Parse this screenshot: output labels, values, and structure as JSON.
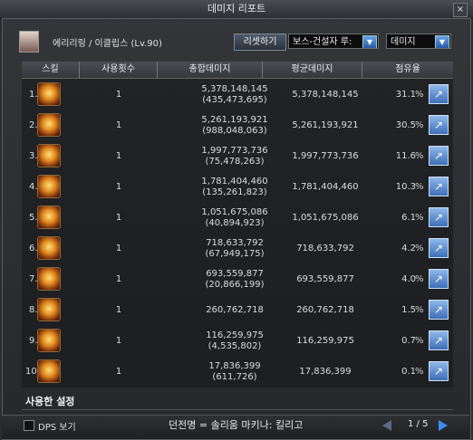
{
  "window": {
    "title": "데미지 리포트",
    "close": "×"
  },
  "header": {
    "character": "에리리링 / 이클립스 (Lv.90)",
    "reset_label": "리셋하기",
    "dungeon_select": "보스-건설자 루:",
    "mode_select": "데미지",
    "dropdown_arrow": "▼"
  },
  "table": {
    "headers": [
      "스킬",
      "사용횟수",
      "총합데미지",
      "평균데미지",
      "점유율"
    ],
    "rows": [
      {
        "rank": "1.",
        "uses": "1",
        "total": "5,378,148,145",
        "sub": "(435,473,695)",
        "avg": "5,378,148,145",
        "share": "31.1",
        "pct": "%"
      },
      {
        "rank": "2.",
        "uses": "1",
        "total": "5,261,193,921",
        "sub": "(988,048,063)",
        "avg": "5,261,193,921",
        "share": "30.5",
        "pct": "%"
      },
      {
        "rank": "3.",
        "uses": "1",
        "total": "1,997,773,736",
        "sub": "(75,478,263)",
        "avg": "1,997,773,736",
        "share": "11.6",
        "pct": "%"
      },
      {
        "rank": "4.",
        "uses": "1",
        "total": "1,781,404,460",
        "sub": "(135,261,823)",
        "avg": "1,781,404,460",
        "share": "10.3",
        "pct": "%"
      },
      {
        "rank": "5.",
        "uses": "1",
        "total": "1,051,675,086",
        "sub": "(40,894,923)",
        "avg": "1,051,675,086",
        "share": "6.1",
        "pct": "%"
      },
      {
        "rank": "6.",
        "uses": "1",
        "total": "718,633,792",
        "sub": "(67,949,175)",
        "avg": "718,633,792",
        "share": "4.2",
        "pct": "%"
      },
      {
        "rank": "7.",
        "uses": "1",
        "total": "693,559,877",
        "sub": "(20,866,199)",
        "avg": "693,559,877",
        "share": "4.0",
        "pct": "%"
      },
      {
        "rank": "8.",
        "uses": "1",
        "total": "260,762,718",
        "sub": "",
        "avg": "260,762,718",
        "share": "1.5",
        "pct": "%"
      },
      {
        "rank": "9.",
        "uses": "1",
        "total": "116,259,975",
        "sub": "(4,535,802)",
        "avg": "116,259,975",
        "share": "0.7",
        "pct": "%"
      },
      {
        "rank": "10.",
        "uses": "1",
        "total": "17,836,399",
        "sub": "(611,726)",
        "avg": "17,836,399",
        "share": "0.1",
        "pct": "%"
      }
    ]
  },
  "tab": {
    "label": "사용한 설정"
  },
  "footer": {
    "dps_label": "DPS 보기",
    "dungeon": "던전명 = 솔리움 마키나: 킬리고",
    "page": "1 / 5"
  }
}
